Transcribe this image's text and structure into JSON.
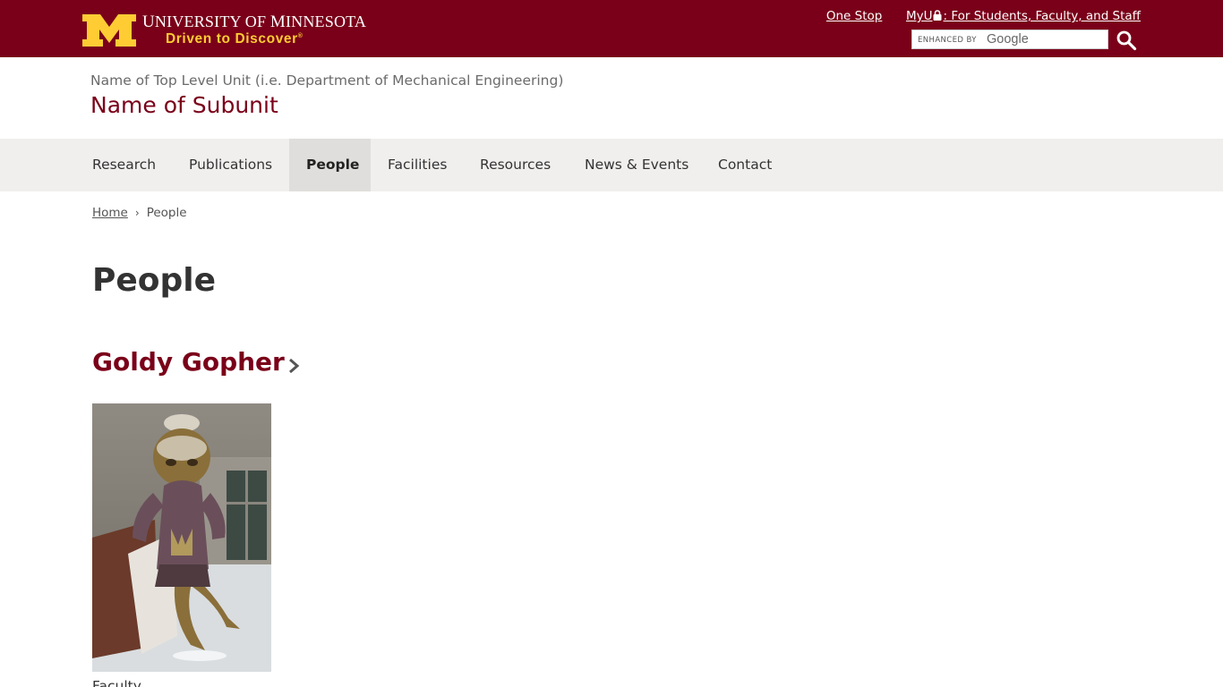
{
  "header": {
    "university": {
      "u": "U",
      "niversity": "NIVERSITY",
      "of": " OF ",
      "m": "M",
      "innesota": "INNESOTA"
    },
    "tagline": "Driven to Discover",
    "tagline_mark": "®",
    "links": [
      {
        "label": "One Stop"
      },
      {
        "label_pre": "MyU",
        "label_post": ": For Students, Faculty, and Staff"
      }
    ],
    "search": {
      "enhanced_by": "ENHANCED BY",
      "provider": "Google"
    }
  },
  "unit": {
    "top_level": "Name of Top Level Unit (i.e. Department of Mechanical Engineering)",
    "subunit": "Name of Subunit"
  },
  "nav": {
    "items": [
      {
        "label": "Research"
      },
      {
        "label": "Publications"
      },
      {
        "label": "People",
        "active": true
      },
      {
        "label": "Facilities"
      },
      {
        "label": "Resources"
      },
      {
        "label": "News & Events"
      },
      {
        "label": "Contact"
      }
    ]
  },
  "breadcrumb": {
    "home": "Home",
    "current": "People"
  },
  "main": {
    "title": "People",
    "person": {
      "name": "Goldy Gopher",
      "role": "Faculty"
    }
  },
  "colors": {
    "maroon": "#7a0019",
    "gold": "#ffcc33",
    "nav_bg": "#f0efee",
    "nav_active": "#e0dedc"
  }
}
